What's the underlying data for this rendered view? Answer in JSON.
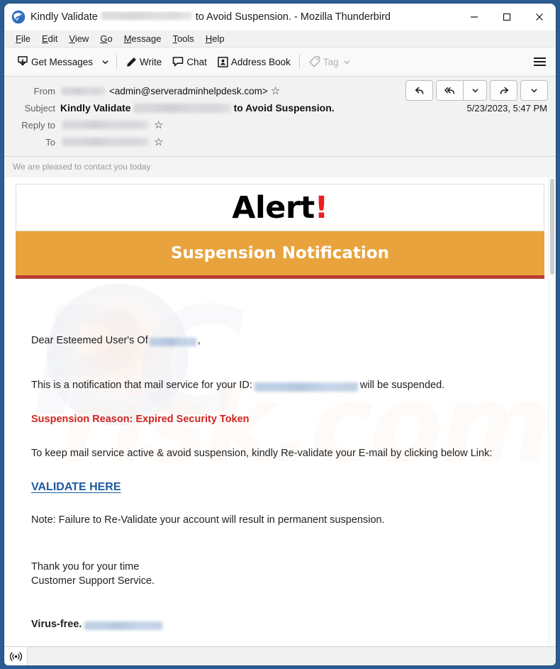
{
  "window": {
    "title_prefix": "Kindly Validate",
    "title_suffix": "to Avoid Suspension. - Mozilla Thunderbird",
    "app_icon": "thunderbird-icon",
    "controls": {
      "minimize": "–",
      "maximize": "□",
      "close": "×"
    }
  },
  "menubar": {
    "items": [
      {
        "pre": "",
        "accel": "F",
        "post": "ile"
      },
      {
        "pre": "",
        "accel": "E",
        "post": "dit"
      },
      {
        "pre": "",
        "accel": "V",
        "post": "iew"
      },
      {
        "pre": "",
        "accel": "G",
        "post": "o"
      },
      {
        "pre": "",
        "accel": "M",
        "post": "essage"
      },
      {
        "pre": "",
        "accel": "T",
        "post": "ools"
      },
      {
        "pre": "",
        "accel": "H",
        "post": "elp"
      }
    ]
  },
  "toolbar": {
    "get_messages_label": "Get Messages",
    "get_messages_icon": "inbox-download-icon",
    "get_messages_chevron": "chevron-down-icon",
    "write_label": "Write",
    "write_icon": "pencil-icon",
    "chat_label": "Chat",
    "chat_icon": "speech-bubble-icon",
    "address_book_label": "Address Book",
    "address_book_icon": "address-book-icon",
    "tag_label": "Tag",
    "tag_icon": "tag-icon",
    "tag_chevron": "chevron-down-icon",
    "app_menu_icon": "hamburger-menu-icon"
  },
  "message_header": {
    "from_label": "From",
    "from_name_redacted": true,
    "from_address": "<admin@serveradminhelpdesk.com>",
    "subject_label": "Subject",
    "subject_prefix": "Kindly Validate",
    "subject_suffix": "to Avoid Suspension.",
    "reply_to_label": "Reply to",
    "reply_to_redacted": true,
    "to_label": "To",
    "to_redacted": true,
    "date": "5/23/2023, 5:47 PM",
    "star_icon": "star-outline-icon",
    "actions": {
      "reply": "reply-icon",
      "reply_all": "reply-all-icon",
      "reply_all_more": "chevron-down-icon",
      "forward": "forward-icon",
      "more": "chevron-down-icon"
    }
  },
  "mail": {
    "preview_line": "We are pleased to contact you today",
    "alert_word": "Alert",
    "alert_bang": "!",
    "suspension_banner": "Suspension Notification",
    "greeting_prefix": "Dear Esteemed User's Of",
    "greeting_suffix": ",",
    "notify_prefix": "This is a notification that mail service for your ID:",
    "notify_suffix": "will be suspended.",
    "reason": "Suspension Reason: Expired Security Token",
    "keep_active": "To keep mail service active & avoid suspension, kindly Re-validate your E-mail by clicking below Link:",
    "validate_link": "VALIDATE HERE",
    "note": "Note: Failure to Re-Validate your account will result in permanent suspension.",
    "thanks": "Thank you for your time",
    "support": "Customer Support Service.",
    "virus_free": "Virus-free.",
    "watermark_primary": "PC",
    "watermark_secondary": "risk.com"
  },
  "statusbar": {
    "network_icon": "broadcast-signal-icon"
  },
  "colors": {
    "window_frame": "#2a5d92",
    "banner_orange": "#e8a33d",
    "banner_border_red": "#ba3c32",
    "alert_bang_red": "#e8201f",
    "reason_red": "#cf2520",
    "link_blue": "#1d5a9e"
  }
}
